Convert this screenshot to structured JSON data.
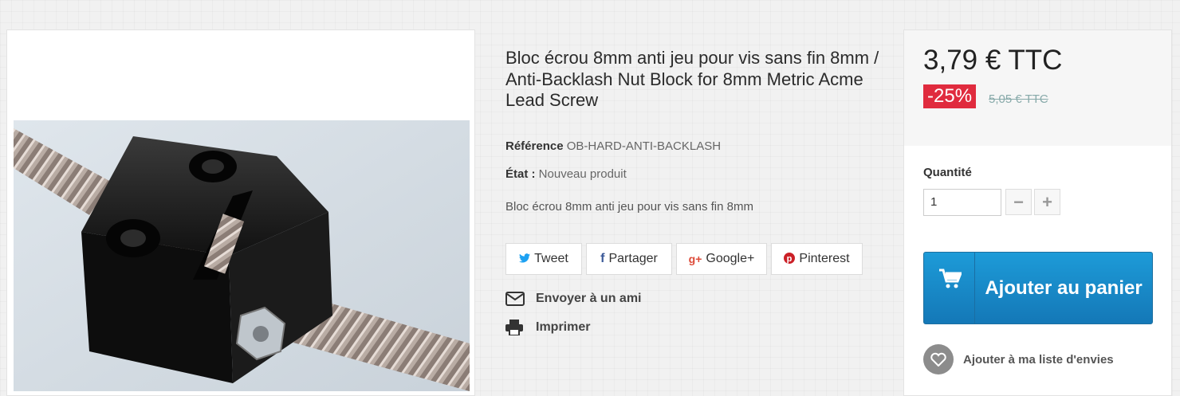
{
  "product": {
    "title": "Bloc écrou 8mm anti jeu pour vis sans fin 8mm / Anti-Backlash Nut Block for 8mm Metric Acme Lead Screw",
    "reference_label": "Référence",
    "reference_value": "OB-HARD-ANTI-BACKLASH",
    "condition_label": "État :",
    "condition_value": "Nouveau produit",
    "short_description": "Bloc écrou 8mm anti jeu pour vis sans fin 8mm"
  },
  "share": {
    "tweet": "Tweet",
    "facebook": "Partager",
    "google": "Google+",
    "pinterest": "Pinterest"
  },
  "actions": {
    "send_friend": "Envoyer à un ami",
    "print": "Imprimer"
  },
  "buy": {
    "price": "3,79 € TTC",
    "discount": "-25%",
    "old_price": "5,05 € TTC",
    "quantity_label": "Quantité",
    "quantity_value": "1",
    "minus": "−",
    "plus": "+",
    "add_to_cart": "Ajouter au panier",
    "wishlist": "Ajouter à ma liste d'envies"
  },
  "colors": {
    "discount_bg": "#e02b3e",
    "cart_button": "#1b8bcb",
    "twitter": "#1da1f2",
    "facebook": "#3b5998",
    "google": "#dd4b39",
    "pinterest": "#cb2027"
  },
  "icons": {
    "twitter": "twitter-icon",
    "facebook": "facebook-icon",
    "google": "google-plus-icon",
    "pinterest": "pinterest-icon",
    "mail": "envelope-icon",
    "print": "printer-icon",
    "cart": "cart-icon",
    "wishlist": "heart-icon"
  }
}
